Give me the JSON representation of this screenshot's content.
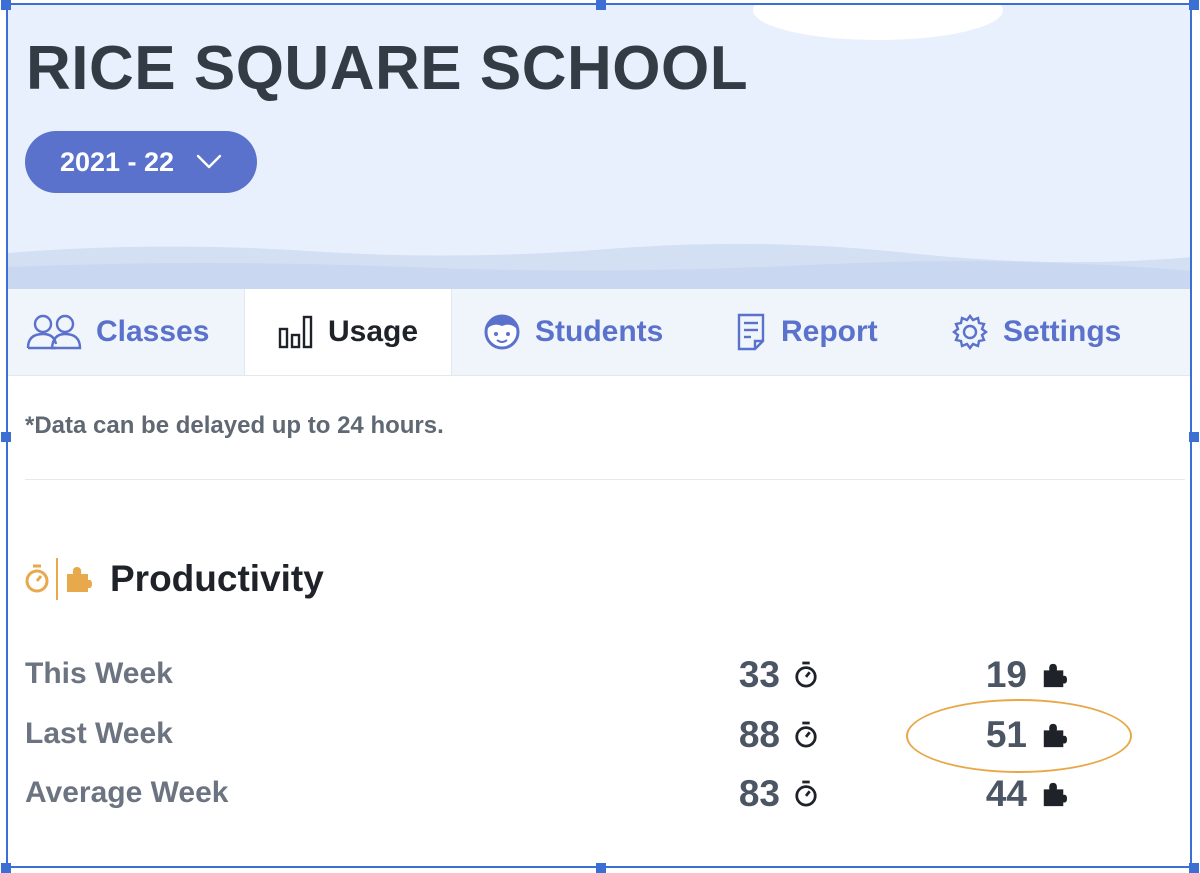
{
  "header": {
    "school_name": "RICE SQUARE SCHOOL",
    "year_selector": "2021 - 22"
  },
  "tabs": [
    {
      "label": "Classes",
      "icon": "people-icon",
      "active": false
    },
    {
      "label": "Usage",
      "icon": "bar-chart-icon",
      "active": true
    },
    {
      "label": "Students",
      "icon": "student-face-icon",
      "active": false
    },
    {
      "label": "Report",
      "icon": "report-icon",
      "active": false
    },
    {
      "label": "Settings",
      "icon": "gear-icon",
      "active": false
    }
  ],
  "notice": "*Data can be delayed up to 24 hours.",
  "productivity": {
    "title": "Productivity",
    "icons": [
      "stopwatch-icon",
      "puzzle-icon"
    ],
    "rows": [
      {
        "label": "This Week",
        "time": "33",
        "puzzles": "19"
      },
      {
        "label": "Last Week",
        "time": "88",
        "puzzles": "51"
      },
      {
        "label": "Average Week",
        "time": "83",
        "puzzles": "44"
      }
    ]
  },
  "colors": {
    "accent": "#5b72cc",
    "header_bg": "#e9f0fd",
    "highlight": "#e8a84a",
    "title_text": "#333b44"
  }
}
